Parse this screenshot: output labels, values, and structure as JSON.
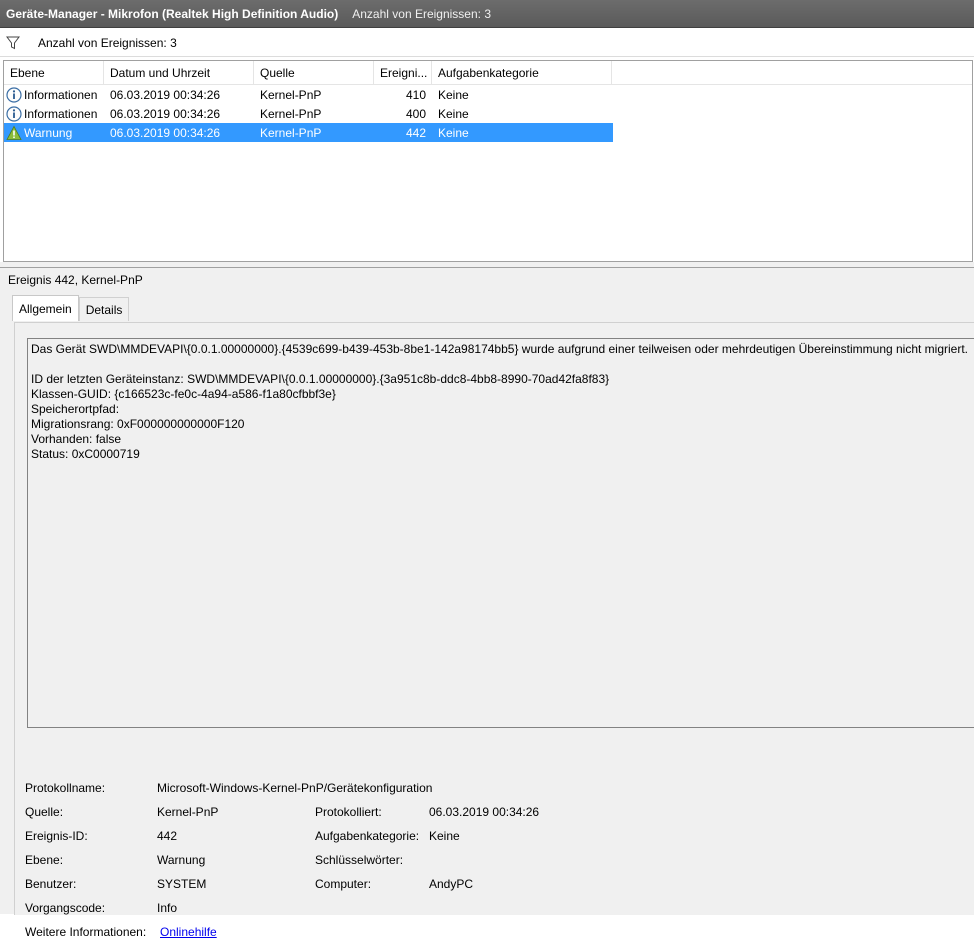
{
  "window": {
    "title": "Geräte-Manager - Mikrofon (Realtek High Definition Audio)",
    "event_count": "Anzahl von Ereignissen: 3"
  },
  "filter": {
    "text": "Anzahl von Ereignissen: 3",
    "icon": "filter-icon"
  },
  "list": {
    "columns": [
      "Ebene",
      "Datum und Uhrzeit",
      "Quelle",
      "Ereigni...",
      "Aufgabenkategorie"
    ],
    "rows": [
      {
        "level": "Informationen",
        "icon": "info-icon",
        "datetime": "06.03.2019 00:34:26",
        "source": "Kernel-PnP",
        "id": "410",
        "category": "Keine"
      },
      {
        "level": "Informationen",
        "icon": "info-icon",
        "datetime": "06.03.2019 00:34:26",
        "source": "Kernel-PnP",
        "id": "400",
        "category": "Keine"
      },
      {
        "level": "Warnung",
        "icon": "warning-icon",
        "datetime": "06.03.2019 00:34:26",
        "source": "Kernel-PnP",
        "id": "442",
        "category": "Keine"
      }
    ]
  },
  "detail": {
    "title": "Ereignis 442, Kernel-PnP",
    "tabs": [
      "Allgemein",
      "Details"
    ],
    "message": "Das Gerät SWD\\MMDEVAPI\\{0.0.1.00000000}.{4539c699-b439-453b-8be1-142a98174bb5} wurde aufgrund einer teilweisen oder mehrdeutigen Übereinstimmung nicht migriert.\n\nID der letzten Geräteinstanz: SWD\\MMDEVAPI\\{0.0.1.00000000}.{3a951c8b-ddc8-4bb8-8990-70ad42fa8f83}\nKlassen-GUID: {c166523c-fe0c-4a94-a586-f1a80cfbbf3e}\nSpeicherortpfad:\nMigrationsrang: 0xF000000000000F120\nVorhanden: false\nStatus: 0xC0000719",
    "props": {
      "protokollname_label": "Protokollname:",
      "protokollname": "Microsoft-Windows-Kernel-PnP/Gerätekonfiguration",
      "quelle_label": "Quelle:",
      "quelle": "Kernel-PnP",
      "protokolliert_label": "Protokolliert:",
      "protokolliert": "06.03.2019 00:34:26",
      "ereignisid_label": "Ereignis-ID:",
      "ereignisid": "442",
      "aufgabe_label": "Aufgabenkategorie:",
      "aufgabe": "Keine",
      "ebene_label": "Ebene:",
      "ebene": "Warnung",
      "schluessel_label": "Schlüsselwörter:",
      "schluessel": "",
      "benutzer_label": "Benutzer:",
      "benutzer": "SYSTEM",
      "computer_label": "Computer:",
      "computer": "AndyPC",
      "vorgang_label": "Vorgangscode:",
      "vorgang": "Info",
      "weitere_label": "Weitere Informationen:",
      "weitere_link": "Onlinehilfe"
    }
  },
  "colors": {
    "selection": "#3399ff",
    "link": "#0000ee",
    "titlebar": "#5f5f5f"
  }
}
